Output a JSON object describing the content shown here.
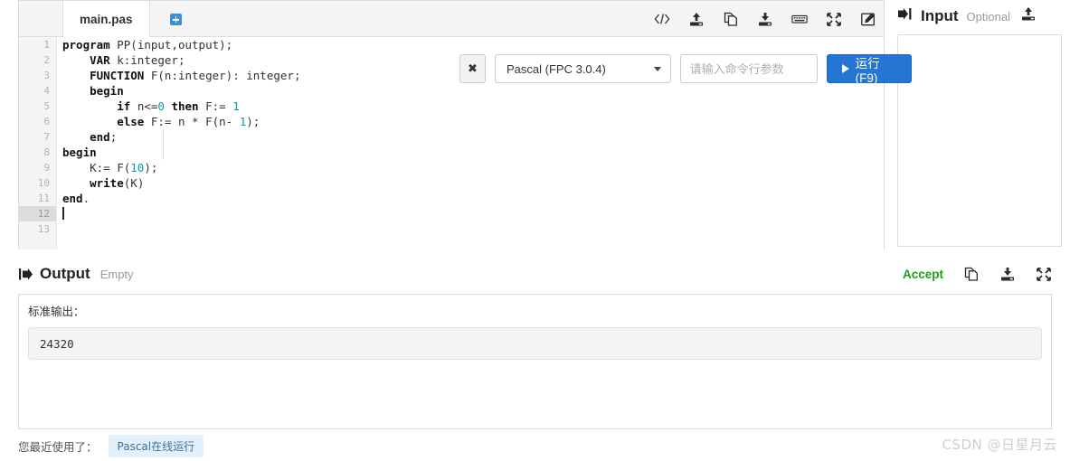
{
  "editor": {
    "tab_label": "main.pas",
    "add_tab_icon": "plus-square-icon",
    "toolbar_icons": [
      {
        "name": "code-brackets-icon",
        "glyph": "</>"
      },
      {
        "name": "upload-icon",
        "glyph": "upload"
      },
      {
        "name": "copy-icon",
        "glyph": "copy"
      },
      {
        "name": "download-icon",
        "glyph": "download"
      },
      {
        "name": "keyboard-icon",
        "glyph": "keyboard"
      },
      {
        "name": "fullscreen-icon",
        "glyph": "expand"
      },
      {
        "name": "edit-icon",
        "glyph": "pencil-square"
      }
    ],
    "line_numbers": [
      "1",
      "2",
      "3",
      "4",
      "5",
      "6",
      "7",
      "8",
      "9",
      "10",
      "11",
      "12",
      "13"
    ],
    "active_line": 12,
    "code_lines": [
      "program PP(input,output);",
      "    VAR k:integer;",
      "    FUNCTION F(n:integer): integer;",
      "    begin",
      "        if n<=0 then F:= 1",
      "        else F:= n * F(n- 1);",
      "    end;",
      "begin",
      "    K:= F(10);",
      "    write(K)",
      "end.",
      "",
      ""
    ]
  },
  "run_controls": {
    "clear_label": "✖",
    "clear_icon": "close-icon",
    "language_value": "Pascal (FPC 3.0.4)",
    "args_placeholder": "请输入命令行参数",
    "args_value": "",
    "run_label": "运行(F9)",
    "run_color": "#2476d2"
  },
  "input_panel": {
    "title": "Input",
    "optional_label": "Optional",
    "upload_icon": "upload-icon",
    "arrow_icon": "arrow-into-box-icon",
    "value": ""
  },
  "output_panel": {
    "icon": "arrow-out-of-box-icon",
    "title": "Output",
    "state": "Empty",
    "accept_label": "Accept",
    "accept_color": "#18a018",
    "actions": [
      {
        "name": "copy-icon",
        "glyph": "copy"
      },
      {
        "name": "download-icon",
        "glyph": "download"
      },
      {
        "name": "fullscreen-icon",
        "glyph": "expand"
      }
    ],
    "stdout_label": "标准输出：",
    "stdout_value": "24320"
  },
  "footer": {
    "recent_label": "您最近使用了：",
    "recent_chip": "Pascal在线运行",
    "watermark": "CSDN @日星月云"
  }
}
